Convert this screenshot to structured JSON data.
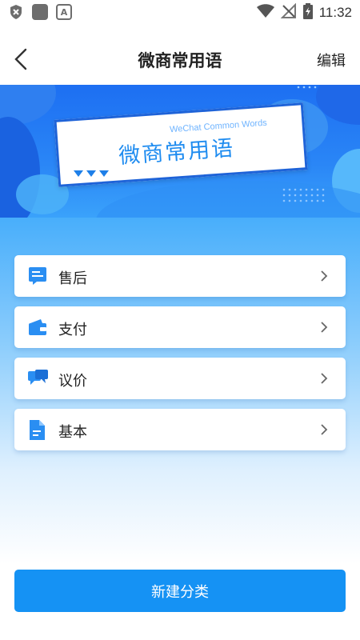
{
  "status_bar": {
    "time": "11:32",
    "icons": [
      "shield-x-icon",
      "app-square-icon",
      "font-a-icon",
      "wifi-icon",
      "no-signal-icon",
      "battery-icon"
    ]
  },
  "nav": {
    "title": "微商常用语",
    "edit_label": "编辑",
    "back_icon": "chevron-left-icon"
  },
  "banner": {
    "title_cn": "微商常用语",
    "title_en": "WeChat Common Words"
  },
  "categories": [
    {
      "label": "售后",
      "icon": "chat-doc-icon"
    },
    {
      "label": "支付",
      "icon": "wallet-icon"
    },
    {
      "label": "议价",
      "icon": "chat-bubbles-icon"
    },
    {
      "label": "基本",
      "icon": "document-icon"
    }
  ],
  "new_category_label": "新建分类",
  "colors": {
    "accent": "#1592f4",
    "banner": "#1d6ff2",
    "icon_blue": "#2a8ef2"
  }
}
